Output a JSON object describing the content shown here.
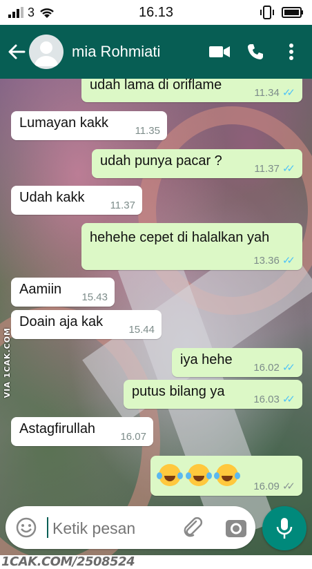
{
  "status_bar": {
    "time": "16.13",
    "signal_bars": "3"
  },
  "header": {
    "contact_name": "mia Rohmiati",
    "bg_color": "#075e54"
  },
  "messages": [
    {
      "dir": "out",
      "text": "udah lama di oriflame",
      "time": "11.34",
      "status": "read"
    },
    {
      "dir": "in",
      "text": "Lumayan kakk",
      "time": "11.35"
    },
    {
      "dir": "out",
      "text": "udah punya pacar ?",
      "time": "11.37",
      "status": "read"
    },
    {
      "dir": "in",
      "text": "Udah kakk",
      "time": "11.37"
    },
    {
      "dir": "out",
      "text": "hehehe cepet di halalkan yah",
      "time": "13.36",
      "status": "read"
    },
    {
      "dir": "in",
      "text": "Aamiin",
      "time": "15.43"
    },
    {
      "dir": "in",
      "text": "Doain aja kak",
      "time": "15.44"
    },
    {
      "dir": "out",
      "text": "iya hehe",
      "time": "16.02",
      "status": "read"
    },
    {
      "dir": "out",
      "text": "putus bilang ya",
      "time": "16.03",
      "status": "read"
    },
    {
      "dir": "in",
      "text": "Astagfirullah",
      "time": "16.07"
    },
    {
      "dir": "out",
      "text": "",
      "emoji": [
        "rolling-on-floor-laughing",
        "rolling-on-floor-laughing",
        "rolling-on-floor-laughing"
      ],
      "time": "16.09",
      "status": "sent"
    }
  ],
  "composer": {
    "placeholder": "Ketik pesan"
  },
  "watermarks": {
    "side": "VIA 1CAK.COM",
    "footer": "1CAK.COM/2508524"
  },
  "colors": {
    "outgoing_bubble": "#dcf8c6",
    "incoming_bubble": "#ffffff",
    "read_tick": "#4fc3f7",
    "mic_button": "#00897b"
  }
}
